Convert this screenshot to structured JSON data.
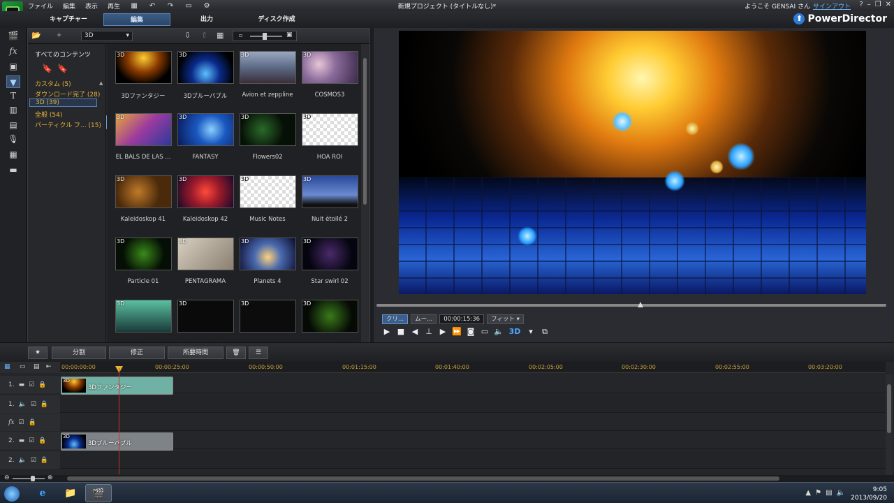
{
  "menu": {
    "items": [
      "ファイル",
      "編集",
      "表示",
      "再生"
    ]
  },
  "title": "新規プロジェクト (タイトルなし)*",
  "user": {
    "greeting": "ようこそ GENSAI さん",
    "signout": "サインアウト",
    "help": "?"
  },
  "modes": {
    "capture": "キャプチャー",
    "edit": "編集",
    "output": "出力",
    "disc": "ディスク作成"
  },
  "brand": "PowerDirector",
  "library": {
    "filter": "3D",
    "all_label": "すべてのコンテンツ",
    "categories": [
      {
        "label": "カスタム  (5)"
      },
      {
        "label": "ダウンロード完了  (28)"
      },
      {
        "label": "3D  (39)"
      },
      {
        "label": "全般  (54)"
      },
      {
        "label": "パーティクル フ...  (15)"
      }
    ],
    "badge": "3D",
    "items": [
      {
        "label": "3Dファンタジー"
      },
      {
        "label": "3Dブルーバブル"
      },
      {
        "label": "Avion et zeppline"
      },
      {
        "label": "COSMOS3"
      },
      {
        "label": "EL BALS DE LAS ..."
      },
      {
        "label": "FANTASY"
      },
      {
        "label": "Flowers02"
      },
      {
        "label": "HOA ROI"
      },
      {
        "label": "Kaleidoskop 41"
      },
      {
        "label": "Kaleidoskop 42"
      },
      {
        "label": "Music Notes"
      },
      {
        "label": "Nuit étoilé 2"
      },
      {
        "label": "Particle 01"
      },
      {
        "label": "PENTAGRAMA"
      },
      {
        "label": "Planets 4"
      },
      {
        "label": "Star swirl 02"
      }
    ]
  },
  "preview": {
    "clip_tab": "クリ...",
    "movie_tab": "ムー...",
    "timecode": "00:00:15:36",
    "fit": "フィット",
    "mode_3d": "3D"
  },
  "toolstrip": {
    "split": "分割",
    "fix": "修正",
    "duration": "所要時間"
  },
  "timeline": {
    "ruler": [
      "00:00:00:00",
      "00:00:25:00",
      "00:00:50:00",
      "00:01:15:00",
      "00:01:40:00",
      "00:02:05:00",
      "00:02:30:00",
      "00:02:55:00",
      "00:03:20:00"
    ],
    "tracks": [
      "1.",
      "1.",
      "fx",
      "2.",
      "2."
    ],
    "clips": [
      {
        "label": "3Dファンタジー",
        "badge": "3D"
      },
      {
        "label": "3Dブルーバブル",
        "badge": "3D"
      }
    ]
  },
  "taskbar": {
    "time": "9:05",
    "date": "2013/09/20"
  }
}
